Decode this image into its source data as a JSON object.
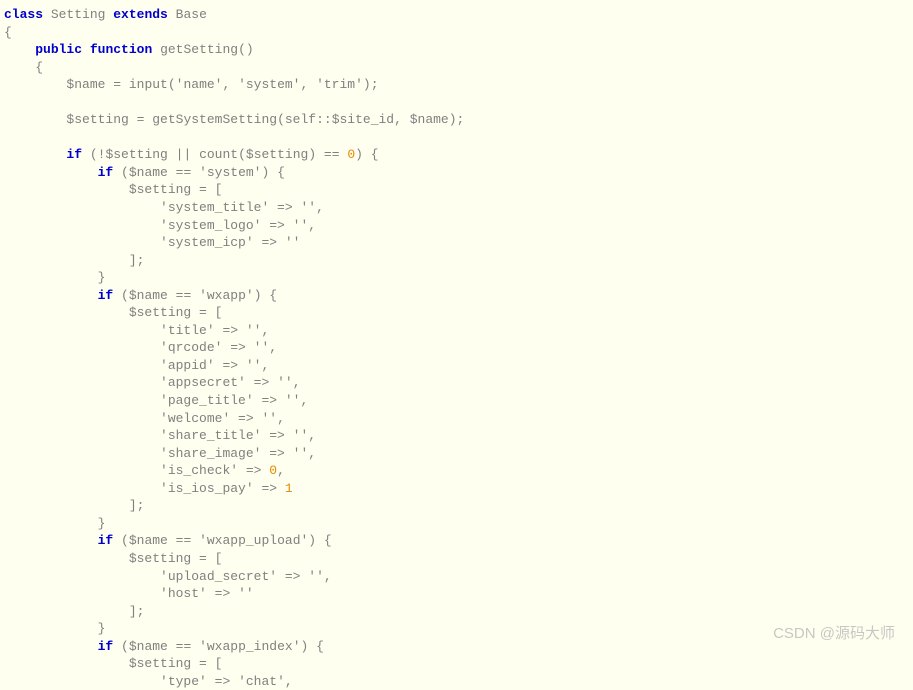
{
  "code": {
    "line01": {
      "kw1": "class",
      "name": "Setting",
      "kw2": "extends",
      "base": "Base"
    },
    "line02": "{",
    "line03": {
      "indent": "    ",
      "kw1": "public",
      "kw2": "function",
      "fn": "getSetting",
      "tail": "()"
    },
    "line04": "    {",
    "line05": {
      "indent": "        ",
      "var": "$name",
      "eq": " = ",
      "fn": "input",
      "args": "('name', 'system', 'trim');"
    },
    "line06": "",
    "line07": {
      "indent": "        ",
      "var": "$setting",
      "eq": " = ",
      "fn": "getSystemSetting",
      "pre": "(self::",
      "v2": "$site_id",
      "mid": ", ",
      "v3": "$name",
      "tail": ");"
    },
    "line08": "",
    "line09": {
      "indent": "        ",
      "kw": "if",
      "pre": " (!",
      "v1": "$setting",
      "op": " || ",
      "fn": "count",
      "op2": "(",
      "v2": "$setting",
      "op3": ") == ",
      "num": "0",
      "tail": ") {"
    },
    "line10": {
      "indent": "            ",
      "kw": "if",
      "pre": " (",
      "v1": "$name",
      "op": " == ",
      "str": "'system'",
      "tail": ") {"
    },
    "line11": {
      "indent": "                ",
      "v1": "$setting",
      "eq": " = ["
    },
    "line12": {
      "indent": "                    ",
      "k": "'system_title'",
      "arrow": " => ",
      "v": "''",
      "c": ","
    },
    "line13": {
      "indent": "                    ",
      "k": "'system_logo'",
      "arrow": " => ",
      "v": "''",
      "c": ","
    },
    "line14": {
      "indent": "                    ",
      "k": "'system_icp'",
      "arrow": " => ",
      "v": "''"
    },
    "line15": "                ];",
    "line16": "            }",
    "line17": {
      "indent": "            ",
      "kw": "if",
      "pre": " (",
      "v1": "$name",
      "op": " == ",
      "str": "'wxapp'",
      "tail": ") {"
    },
    "line18": {
      "indent": "                ",
      "v1": "$setting",
      "eq": " = ["
    },
    "line19": {
      "indent": "                    ",
      "k": "'title'",
      "arrow": " => ",
      "v": "''",
      "c": ","
    },
    "line20": {
      "indent": "                    ",
      "k": "'qrcode'",
      "arrow": " => ",
      "v": "''",
      "c": ","
    },
    "line21": {
      "indent": "                    ",
      "k": "'appid'",
      "arrow": " => ",
      "v": "''",
      "c": ","
    },
    "line22": {
      "indent": "                    ",
      "k": "'appsecret'",
      "arrow": " => ",
      "v": "''",
      "c": ","
    },
    "line23": {
      "indent": "                    ",
      "k": "'page_title'",
      "arrow": " => ",
      "v": "''",
      "c": ","
    },
    "line24": {
      "indent": "                    ",
      "k": "'welcome'",
      "arrow": " => ",
      "v": "''",
      "c": ","
    },
    "line25": {
      "indent": "                    ",
      "k": "'share_title'",
      "arrow": " => ",
      "v": "''",
      "c": ","
    },
    "line26": {
      "indent": "                    ",
      "k": "'share_image'",
      "arrow": " => ",
      "v": "''",
      "c": ","
    },
    "line27": {
      "indent": "                    ",
      "k": "'is_check'",
      "arrow": " => ",
      "num": "0",
      "c": ","
    },
    "line28": {
      "indent": "                    ",
      "k": "'is_ios_pay'",
      "arrow": " => ",
      "num": "1"
    },
    "line29": "                ];",
    "line30": "            }",
    "line31": {
      "indent": "            ",
      "kw": "if",
      "pre": " (",
      "v1": "$name",
      "op": " == ",
      "str": "'wxapp_upload'",
      "tail": ") {"
    },
    "line32": {
      "indent": "                ",
      "v1": "$setting",
      "eq": " = ["
    },
    "line33": {
      "indent": "                    ",
      "k": "'upload_secret'",
      "arrow": " => ",
      "v": "''",
      "c": ","
    },
    "line34": {
      "indent": "                    ",
      "k": "'host'",
      "arrow": " => ",
      "v": "''"
    },
    "line35": "                ];",
    "line36": "            }",
    "line37": {
      "indent": "            ",
      "kw": "if",
      "pre": " (",
      "v1": "$name",
      "op": " == ",
      "str": "'wxapp_index'",
      "tail": ") {"
    },
    "line38": {
      "indent": "                ",
      "v1": "$setting",
      "eq": " = ["
    },
    "line39": {
      "indent": "                    ",
      "k": "'type'",
      "arrow": " => ",
      "v": "'chat'",
      "c": ","
    }
  },
  "watermark": "CSDN @源码大师"
}
